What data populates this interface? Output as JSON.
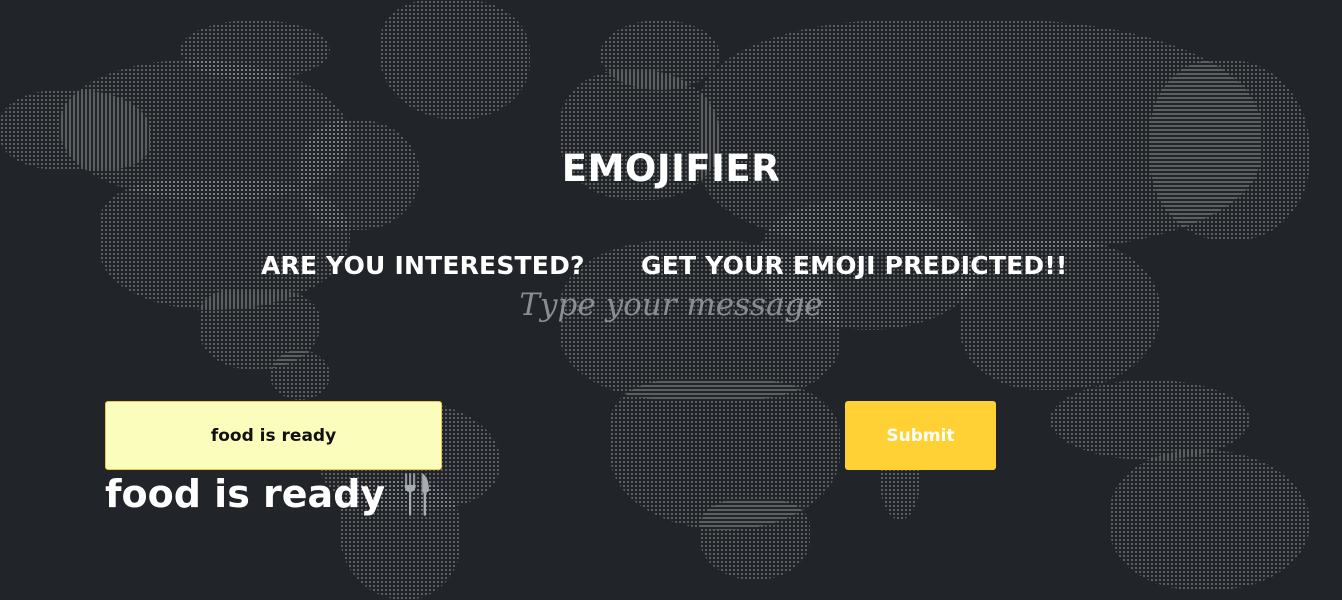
{
  "app": {
    "title": "EMOJIFIER"
  },
  "hero": {
    "tagline_left": "ARE YOU INTERESTED?",
    "tagline_right": "GET YOUR EMOJI PREDICTED!!",
    "prompt": "Type your message"
  },
  "form": {
    "message_value": "food is ready",
    "submit_label": "Submit"
  },
  "result": {
    "text": "food is ready",
    "emoji_icon": "fork-and-knife-icon"
  },
  "colors": {
    "background": "#212428",
    "input_background": "#fbfdbd",
    "submit_background": "#ffd135",
    "prompt_text": "#8a8d93",
    "heading_text": "#ffffff"
  }
}
